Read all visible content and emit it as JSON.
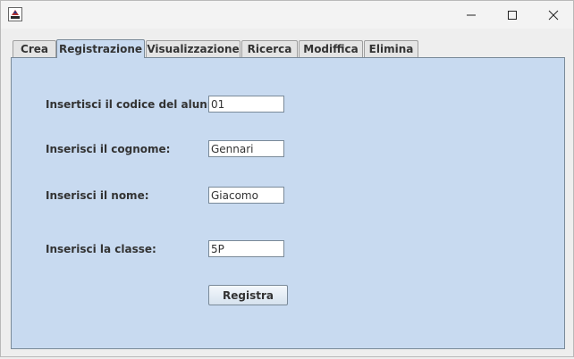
{
  "tabs": [
    {
      "label": "Crea"
    },
    {
      "label": "Registrazione"
    },
    {
      "label": "Visualizzazione"
    },
    {
      "label": "Ricerca"
    },
    {
      "label": "Modiffica"
    },
    {
      "label": "Elimina"
    }
  ],
  "selected_tab": "Registrazione",
  "form": {
    "codice_label": "Insertisci il codice del alunno:",
    "codice_value": "01",
    "cognome_label": "Inserisci il cognome:",
    "cognome_value": "Gennari",
    "nome_label": "Inserisci il nome:",
    "nome_value": "Giacomo",
    "classe_label": "Inserisci la classe:",
    "classe_value": "5P",
    "submit_label": "Registra"
  },
  "colors": {
    "panel": "#c8daf0",
    "tab": "#e4e4e4",
    "titlebar": "#f3f3f3"
  },
  "icons": {
    "app": "java-cup-icon",
    "minimize": "minimize-icon",
    "maximize": "maximize-icon",
    "close": "close-icon"
  }
}
